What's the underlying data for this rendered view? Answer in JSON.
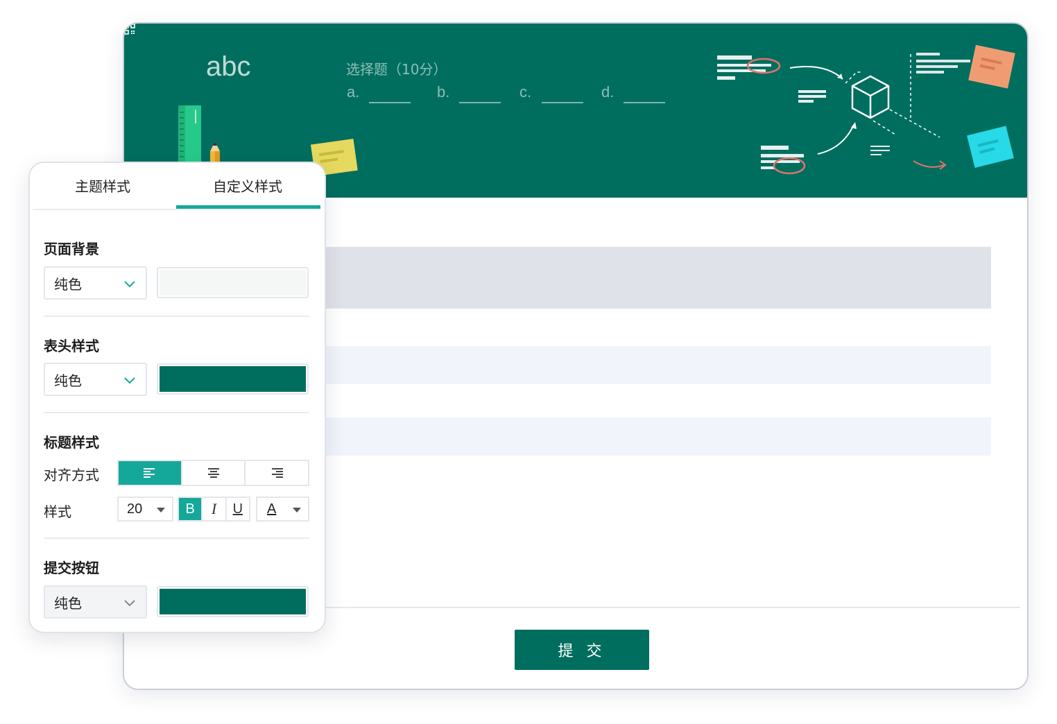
{
  "banner": {
    "decor_text": "abc",
    "question_title": "选择题（10分）",
    "options": [
      "a.",
      "b.",
      "c.",
      "d."
    ],
    "bg_color": "#006e5f",
    "icons": [
      "ruler-icon",
      "pencil-icon",
      "sticky-note-icon",
      "cube-icon",
      "qr-code-icon"
    ]
  },
  "form": {
    "submit_label": "提 交",
    "submit_color": "#006e5f"
  },
  "panel": {
    "tabs": [
      {
        "label": "主题样式",
        "active": false
      },
      {
        "label": "自定义样式",
        "active": true
      }
    ],
    "accent_color": "#14a89a",
    "page_background": {
      "title": "页面背景",
      "fill_type": "纯色",
      "color": "#f4f7f6"
    },
    "header_style": {
      "title": "表头样式",
      "fill_type": "纯色",
      "color": "#006e5f"
    },
    "title_style": {
      "title": "标题样式",
      "align_label": "对齐方式",
      "align_options": [
        "left",
        "center",
        "right"
      ],
      "align_selected": "left",
      "style_label": "样式",
      "font_size": "20",
      "bold_label": "B",
      "italic_label": "I",
      "underline_label": "U",
      "bold_active": true,
      "color_label": "A"
    },
    "submit_button": {
      "title": "提交按钮",
      "fill_type": "纯色",
      "color": "#006e5f"
    }
  }
}
